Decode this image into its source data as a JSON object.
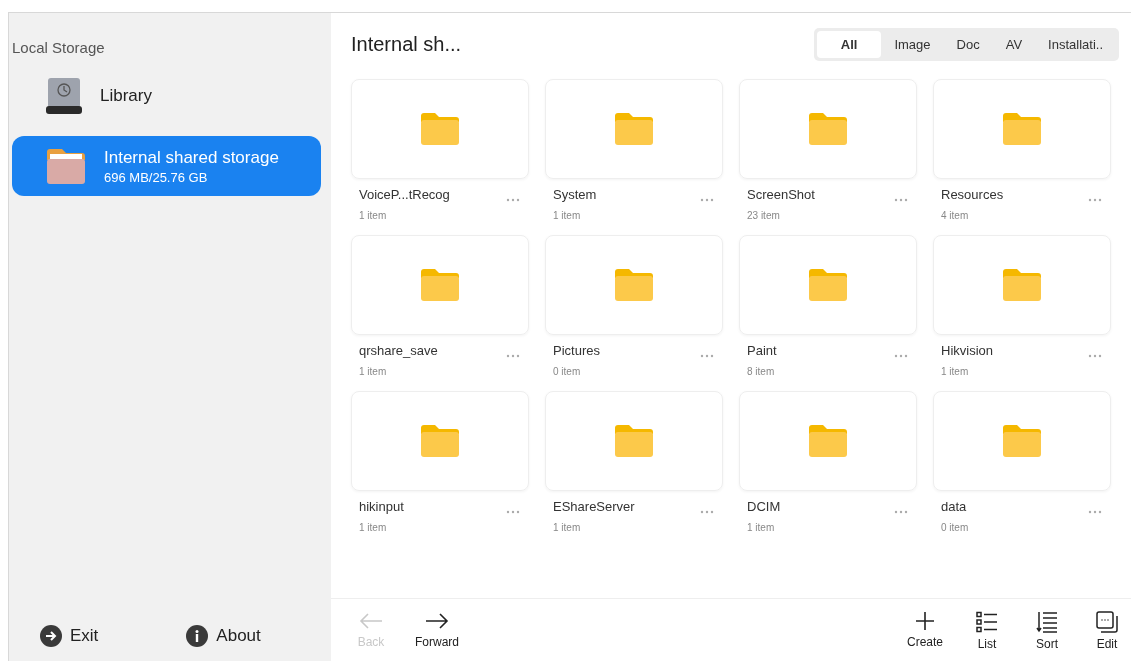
{
  "sidebar": {
    "heading": "Local Storage",
    "items": [
      {
        "kind": "library",
        "label": "Library",
        "selected": false
      },
      {
        "kind": "storage",
        "label": "Internal shared storage",
        "detail": "696 MB/25.76 GB",
        "selected": true
      }
    ],
    "footer": [
      {
        "kind": "exit",
        "label": "Exit"
      },
      {
        "kind": "about",
        "label": "About"
      }
    ]
  },
  "header": {
    "title": "Internal sh...",
    "tabs": [
      {
        "label": "All",
        "selected": true
      },
      {
        "label": "Image",
        "selected": false
      },
      {
        "label": "Doc",
        "selected": false
      },
      {
        "label": "AV",
        "selected": false
      },
      {
        "label": "Installati..",
        "selected": false
      }
    ]
  },
  "folders": [
    {
      "name": "VoiceP...tRecog",
      "count": "1 item"
    },
    {
      "name": "System",
      "count": "1 item"
    },
    {
      "name": "ScreenShot",
      "count": "23 item"
    },
    {
      "name": "Resources",
      "count": "4 item"
    },
    {
      "name": "qrshare_save",
      "count": "1 item"
    },
    {
      "name": "Pictures",
      "count": "0 item"
    },
    {
      "name": "Paint",
      "count": "8 item"
    },
    {
      "name": "Hikvision",
      "count": "1 item"
    },
    {
      "name": "hikinput",
      "count": "1 item"
    },
    {
      "name": "EShareServer",
      "count": "1 item"
    },
    {
      "name": "DCIM",
      "count": "1 item"
    },
    {
      "name": "data",
      "count": "0 item"
    }
  ],
  "toolbar": {
    "left": [
      {
        "kind": "back",
        "label": "Back",
        "disabled": true
      },
      {
        "kind": "forward",
        "label": "Forward",
        "disabled": false
      }
    ],
    "right": [
      {
        "kind": "create",
        "label": "Create",
        "disabled": false
      },
      {
        "kind": "list",
        "label": "List",
        "disabled": false
      },
      {
        "kind": "sort",
        "label": "Sort",
        "disabled": false
      },
      {
        "kind": "edit",
        "label": "Edit",
        "disabled": false
      }
    ]
  }
}
